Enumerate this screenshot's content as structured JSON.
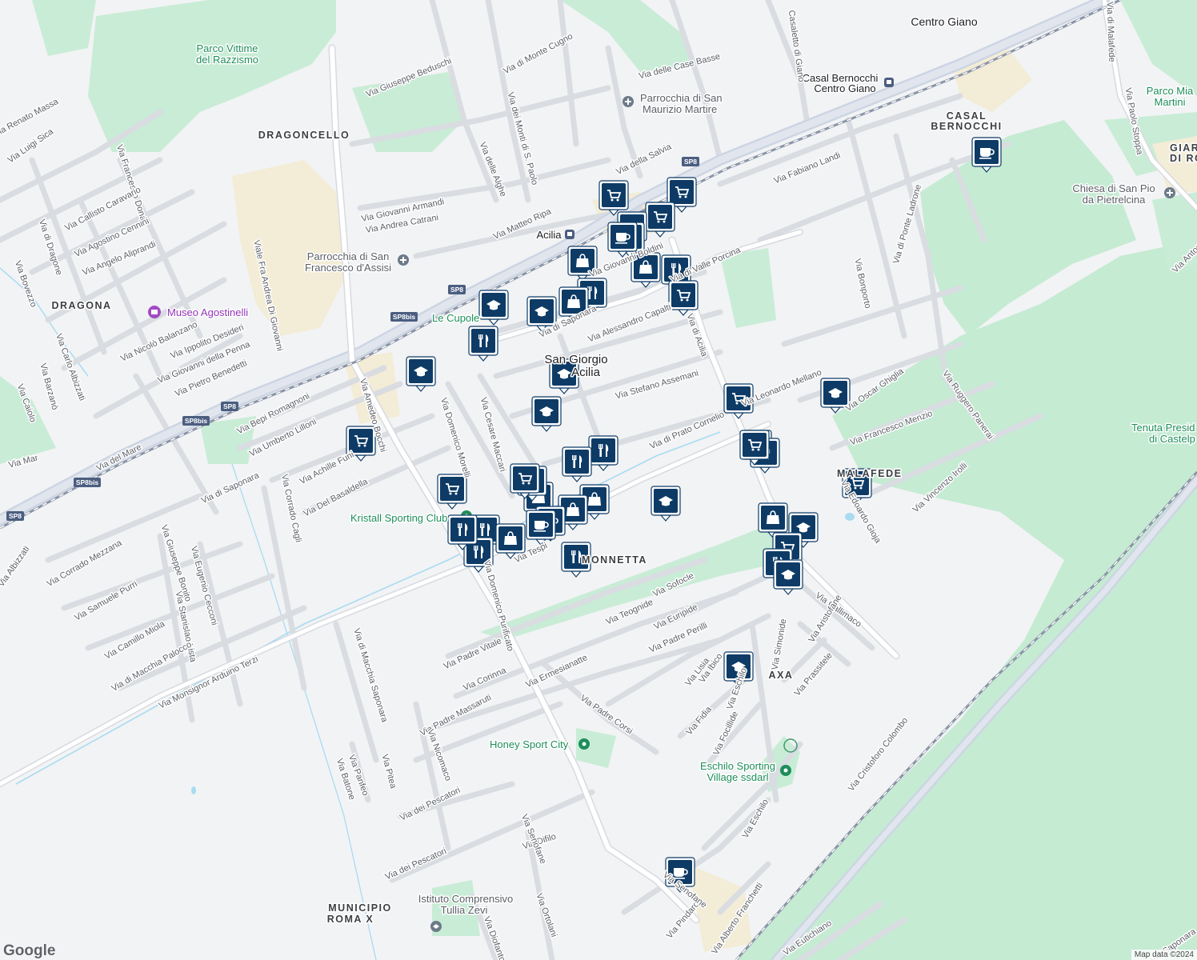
{
  "map": {
    "colors": {
      "background": "#f2f3f5",
      "park": "#bfe8cf",
      "sand": "#f3ecd6",
      "road": "#ffffff",
      "road_outline": "#d7dadf",
      "highway": "#cdd5e3",
      "rail": "#8a94a6",
      "water": "#a9dbf1",
      "marker": "#0d3b66"
    },
    "labels": {
      "neighborhoods": [
        {
          "id": "dragoncello",
          "text": "DRAGONCELLO"
        },
        {
          "id": "dragona",
          "text": "DRAGONA"
        },
        {
          "id": "casal1",
          "text": "CASAL"
        },
        {
          "id": "casal2",
          "text": "BERNOCCHI"
        },
        {
          "id": "giardin1",
          "text": "GIARDIN"
        },
        {
          "id": "giardin2",
          "text": "DI ROMA"
        },
        {
          "id": "malafede",
          "text": "MALAFEDE"
        },
        {
          "id": "axa",
          "text": "AXA"
        },
        {
          "id": "monnetta",
          "text": "MONNETTA"
        },
        {
          "id": "municipio1",
          "text": "MUNICIPIO"
        },
        {
          "id": "municipio2",
          "text": "ROMA X"
        }
      ],
      "places": [
        {
          "id": "centro-giano",
          "text": "Centro Giano"
        },
        {
          "id": "sangiorgio1",
          "text": "San Giorgio"
        },
        {
          "id": "sangiorgio2",
          "text": "Acilia"
        },
        {
          "id": "parrocchia-fr1",
          "text": "Parrocchia di San"
        },
        {
          "id": "parrocchia-fr2",
          "text": "Francesco d'Assisi"
        },
        {
          "id": "parrocchia-mm1",
          "text": "Parrocchia di San"
        },
        {
          "id": "parrocchia-mm2",
          "text": "Maurizio Martire"
        },
        {
          "id": "chiesa1",
          "text": "Chiesa di San Pio"
        },
        {
          "id": "chiesa2",
          "text": "da Pietrelcina"
        },
        {
          "id": "istituto1",
          "text": "Istituto Comprensivo"
        },
        {
          "id": "istituto2",
          "text": "Tullia Zevi"
        }
      ],
      "parks": [
        {
          "id": "parco-vittime1",
          "text": "Parco Vittime"
        },
        {
          "id": "parco-vittime2",
          "text": "del Razzismo"
        },
        {
          "id": "parco-mia1",
          "text": "Parco Mia"
        },
        {
          "id": "parco-mia2",
          "text": "Martini"
        },
        {
          "id": "le-cupole",
          "text": "Le Cupole"
        },
        {
          "id": "kristall",
          "text": "Kristall Sporting Club"
        },
        {
          "id": "honey",
          "text": "Honey Sport City"
        },
        {
          "id": "eschilo1",
          "text": "Eschilo Sporting"
        },
        {
          "id": "eschilo2",
          "text": "Village ssdarl"
        },
        {
          "id": "tenuta1",
          "text": "Tenuta Presid"
        },
        {
          "id": "tenuta2",
          "text": "di Castelp"
        }
      ],
      "museum": "Museo Agostinelli",
      "stations": [
        {
          "id": "casal-bernocchi1",
          "text": "Casal Bernocchi"
        },
        {
          "id": "casal-bernocchi2",
          "text": "Centro Giano"
        },
        {
          "id": "acilia",
          "text": "Acilia"
        }
      ],
      "shields": [
        "SP8",
        "SP8",
        "SP8bis",
        "SP8bis",
        "SP8",
        "SP8bis",
        "SP8",
        "SP8bis",
        "SP8"
      ],
      "streets": [
        "Via del Mare",
        "Via di Malafede",
        "Via di Monte Cugno",
        "Via Giuseppe Beduschi",
        "Via delle Case Basse",
        "Casaletto di Giano",
        "Via dei Monti di S. Paolo",
        "Via delle Alghe",
        "Via della Salvia",
        "Via Giovanni Armandi",
        "Via Andrea Catrani",
        "Via Matteo Ripa",
        "Via Fabiano Landi",
        "Via di Ponte Ladrone",
        "Via Paolo Stoppa",
        "Via Renato Massa",
        "Via Luigi Sica",
        "Via Francesco Donati",
        "Via Callisto Caravario",
        "Via Agostino Cennini",
        "Via Angelo Aliprandi",
        "Via di Dragone",
        "Via Bovezzo",
        "Viale Fra Andrea Di Giovanni",
        "Via Nicolò Balanzano",
        "Via Ippolito Desideri",
        "Via Giovanni della Penna",
        "Via Pietro Benedetti",
        "Via Carlo Albizzati",
        "Via Barzanò",
        "Via Caiolo",
        "Via Bepi Romagnoni",
        "Via Umberto Lilloni",
        "Via Amedeo Bocchi",
        "Via Domenico Morelli",
        "Via Cesare Maccari",
        "Via di Saponara",
        "Via Alessandro Capalti",
        "Via di Valle Porcina",
        "Via Giovanni Boldini",
        "Via di Acilia",
        "Via Stefano Assemani",
        "Via Bonporto",
        "Via Oscar Ghiglia",
        "Via Ruggero Panerai",
        "Via Leonardo Mellano",
        "Via di Prato Cornelio",
        "Via Francesco Menzio",
        "Via Edoardo Gioja",
        "Via Vincenzo Irolli",
        "Via Cristoforo Colombo",
        "Via Achille Funi",
        "Via Del Basaldella",
        "Via Corrado Cagli",
        "Via di Saponara",
        "Via Corrado Mezzana",
        "Via Samuele Purri",
        "Via Giuseppe Bonito",
        "Via Eugenio Cecconi",
        "Via Stanislao Lista",
        "Via Camillo Miola",
        "Via di Macchia Palocco",
        "Via Monsignor Arduino Terzi",
        "Via di Macchia Saponara",
        "Via Domenico Purificato",
        "Via Tespi",
        "Via Sofocle",
        "Via Teognide",
        "Via Euripide",
        "Via Padre Perilli",
        "Via Padre Vitale",
        "Via Corinna",
        "Via Ermesianatte",
        "Via Lisia",
        "Via Ibico",
        "Via Eschilo",
        "Via Simonide",
        "Via Callimaco",
        "Via Aristofane",
        "Via Prassitele",
        "Via Fidia",
        "Via Focillide",
        "Via Padre Corsi",
        "Via Padre Massaruti",
        "Via Nicomaco",
        "Via Pitea",
        "Via Panfeo",
        "Via Batone",
        "Via dei Pescatori",
        "Via dei Pescatori",
        "Via Difilo",
        "Via Senofane",
        "Via Pindaro",
        "Via Senofane",
        "Via Eschilo",
        "Via Alberto Franchetti",
        "Via Eutichiano",
        "Via Diofanto",
        "Via Ortolani",
        "Via Albizzati",
        "Via Mar",
        "Via Anton",
        "Via Saponara"
      ]
    },
    "poi_markers": [
      {
        "kind": "cart"
      },
      {
        "kind": "cart"
      },
      {
        "kind": "cart"
      },
      {
        "kind": "cafe"
      },
      {
        "kind": "cart"
      },
      {
        "kind": "cafe"
      },
      {
        "kind": "bag"
      },
      {
        "kind": "bag"
      },
      {
        "kind": "fork"
      },
      {
        "kind": "fork"
      },
      {
        "kind": "bag"
      },
      {
        "kind": "cart"
      },
      {
        "kind": "school"
      },
      {
        "kind": "school"
      },
      {
        "kind": "fork"
      },
      {
        "kind": "school"
      },
      {
        "kind": "school"
      },
      {
        "kind": "school"
      },
      {
        "kind": "cart"
      },
      {
        "kind": "school"
      },
      {
        "kind": "cafe"
      },
      {
        "kind": "cart"
      },
      {
        "kind": "cart"
      },
      {
        "kind": "fork"
      },
      {
        "kind": "fork"
      },
      {
        "kind": "fork"
      },
      {
        "kind": "fork"
      },
      {
        "kind": "cart"
      },
      {
        "kind": "cart"
      },
      {
        "kind": "bag"
      },
      {
        "kind": "bag"
      },
      {
        "kind": "fork"
      },
      {
        "kind": "bag"
      },
      {
        "kind": "school"
      },
      {
        "kind": "cafe"
      },
      {
        "kind": "fork"
      },
      {
        "kind": "cafe"
      },
      {
        "kind": "fork"
      },
      {
        "kind": "fork"
      },
      {
        "kind": "bag"
      },
      {
        "kind": "fork"
      },
      {
        "kind": "bag"
      },
      {
        "kind": "school"
      },
      {
        "kind": "cart"
      },
      {
        "kind": "fork"
      },
      {
        "kind": "school"
      },
      {
        "kind": "school"
      },
      {
        "kind": "cafe"
      },
      {
        "kind": "cart"
      }
    ]
  },
  "footer": {
    "logo": "Google",
    "attribution": "Map data ©2024"
  }
}
